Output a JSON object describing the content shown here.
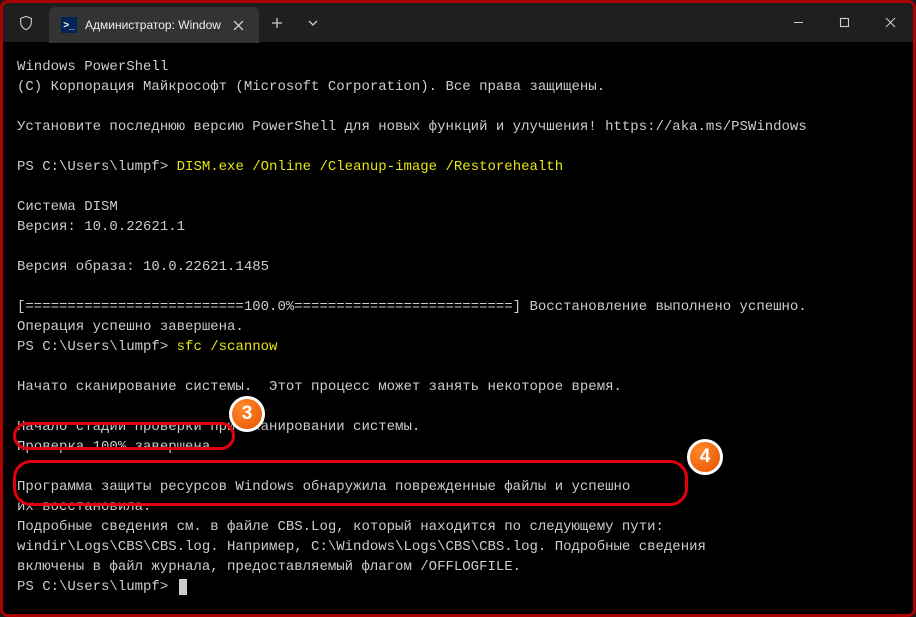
{
  "titlebar": {
    "tab_title": "Администратор: Windows Po",
    "ps_icon": ">_"
  },
  "term": {
    "l1": "Windows PowerShell",
    "l2": "(C) Корпорация Майкрософт (Microsoft Corporation). Все права защищены.",
    "l3": "Установите последнюю версию PowerShell для новых функций и улучшения! https://aka.ms/PSWindows",
    "p1": "PS C:\\Users\\lumpf> ",
    "cmd1": "DISM.exe /Online /Cleanup-image /Restorehealth",
    "l5": "Cистема DISM",
    "l6": "Версия: 10.0.22621.1",
    "l7": "Версия образа: 10.0.22621.1485",
    "l8": "[==========================100.0%==========================] Восстановление выполнено успешно.",
    "l9": "Операция успешно завершена.",
    "p2": "PS C:\\Users\\lumpf> ",
    "cmd2": "sfc /scannow",
    "l10": "Начато сканирование системы.  Этот процесс может занять некоторое время.",
    "l11": "Начало стадии проверки при сканировании системы.",
    "l12": "Проверка 100% завершена.",
    "l13": "Программа защиты ресурсов Windows обнаружила поврежденные файлы и успешно",
    "l14": "их восстановила.",
    "l15": "Подробные сведения см. в файле CBS.Log, который находится по следующему пути:",
    "l16": "windir\\Logs\\CBS\\CBS.log. Например, C:\\Windows\\Logs\\CBS\\CBS.log. Подробные сведения",
    "l17": "включены в файл журнала, предоставляемый флагом /OFFLOGFILE.",
    "p3": "PS C:\\Users\\lumpf> "
  },
  "badges": {
    "b3": "3",
    "b4": "4"
  }
}
